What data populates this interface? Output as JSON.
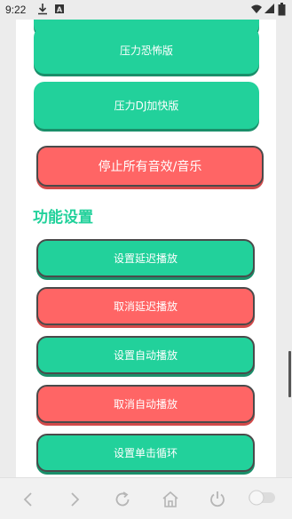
{
  "status_bar": {
    "time": "9:22",
    "icons": [
      "download-icon",
      "notification-a-icon",
      "wifi-icon",
      "cellular-icon",
      "battery-icon"
    ]
  },
  "buttons": {
    "horror_version": "压力恐怖版",
    "dj_fast_version": "压力DJ加快版",
    "stop_all": "停止所有音效/音乐"
  },
  "settings": {
    "title": "功能设置",
    "set_delay": "设置延迟播放",
    "cancel_delay": "取消延迟播放",
    "set_auto": "设置自动播放",
    "cancel_auto": "取消自动播放",
    "set_loop": "设置单击循环"
  },
  "browser_nav": {
    "icons": [
      "back-icon",
      "forward-icon",
      "refresh-icon",
      "home-icon",
      "power-icon",
      "toggle-icon"
    ]
  },
  "colors": {
    "green": "#22d19b",
    "red": "#ff6565",
    "background": "#ececec"
  }
}
